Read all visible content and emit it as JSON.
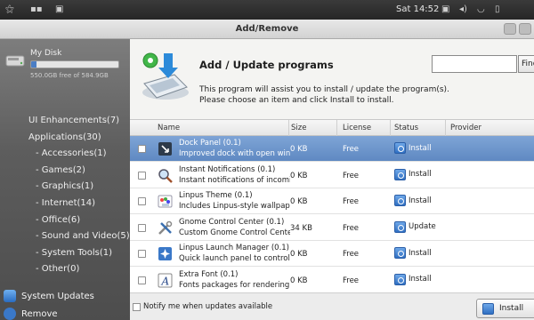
{
  "top_panel": {
    "clock": "Sat 14:52",
    "icons": [
      "apps-icon",
      "workspaces-icon",
      "window-icon",
      "screen-icon",
      "volume-icon",
      "wifi-icon",
      "battery-icon"
    ]
  },
  "window": {
    "title": "Add/Remove"
  },
  "sidebar": {
    "disk_name": "My Disk",
    "disk_free": "550.0GB free of 584.9GB",
    "disk_used_fraction": 0.06,
    "categories": [
      {
        "label": "UI Enhancements(7)",
        "sub": false
      },
      {
        "label": "Applications(30)",
        "sub": false
      },
      {
        "label": "- Accessories(1)",
        "sub": true
      },
      {
        "label": "- Games(2)",
        "sub": true
      },
      {
        "label": "- Graphics(1)",
        "sub": true
      },
      {
        "label": "- Internet(14)",
        "sub": true
      },
      {
        "label": "- Office(6)",
        "sub": true
      },
      {
        "label": "- Sound and Video(5)",
        "sub": true
      },
      {
        "label": "- System Tools(1)",
        "sub": true
      },
      {
        "label": "- Other(0)",
        "sub": true
      }
    ],
    "system_updates": "System Updates",
    "remove": "Remove"
  },
  "header": {
    "title": "Add / Update programs",
    "desc_line1": "This program will assist you to install / update the program(s).",
    "desc_line2": "Please choose an item and click Install to install.",
    "search_value": "",
    "find_label": "Find"
  },
  "table": {
    "columns": {
      "name": "Name",
      "size": "Size",
      "license": "License",
      "status": "Status",
      "provider": "Provider"
    },
    "rows": [
      {
        "name": "Dock Panel (0.1)",
        "desc": "Improved dock with open windo",
        "size": "0  KB",
        "license": "Free",
        "status": "Install",
        "icon": "dock-icon",
        "selected": true
      },
      {
        "name": "Instant Notifications (0.1)",
        "desc": "Instant notifications of incoming",
        "size": "0  KB",
        "license": "Free",
        "status": "Install",
        "icon": "magnifier-icon",
        "selected": false
      },
      {
        "name": "Linpus Theme (0.1)",
        "desc": "Includes Linpus-style wallpaper",
        "size": "0  KB",
        "license": "Free",
        "status": "Install",
        "icon": "theme-icon",
        "selected": false
      },
      {
        "name": "Gnome Control Center (0.1)",
        "desc": "Custom Gnome Control Center",
        "size": "34 KB",
        "license": "Free",
        "status": "Update",
        "icon": "tools-icon",
        "selected": false
      },
      {
        "name": "Linpus Launch Manager (0.1)",
        "desc": "Quick launch panel to control th",
        "size": "0  KB",
        "license": "Free",
        "status": "Install",
        "icon": "launcher-icon",
        "selected": false
      },
      {
        "name": "Extra Font (0.1)",
        "desc": "Fonts packages for rendering te",
        "size": "0  KB",
        "license": "Free",
        "status": "Install",
        "icon": "font-icon",
        "selected": false
      }
    ]
  },
  "footer": {
    "notify_label": "Notify me when updates available",
    "install_label": "Install"
  }
}
